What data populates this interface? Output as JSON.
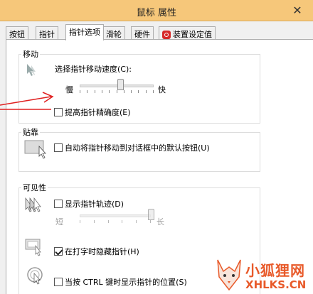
{
  "window": {
    "title": "鼠标 属性",
    "close_glyph": "✕"
  },
  "tabs": [
    {
      "label": "按钮"
    },
    {
      "label": "指针"
    },
    {
      "label": "指针选项"
    },
    {
      "label": "滑轮"
    },
    {
      "label": "硬件"
    },
    {
      "label": "装置设定值",
      "icon": "red-device-icon"
    }
  ],
  "motion": {
    "group_label": "移动",
    "speed_label": "选择指针移动速度(C):",
    "slow_label": "慢",
    "fast_label": "快",
    "speed_level": 0.55,
    "precision_label": "提高指针精确度(E)",
    "precision_checked": false
  },
  "snap": {
    "group_label": "贴靠",
    "label": "自动将指针移动到对话框中的默认按钮(U)",
    "checked": false
  },
  "visibility": {
    "group_label": "可见性",
    "trails_label": "显示指针轨迹(D)",
    "trails_checked": false,
    "short_label": "短",
    "long_label": "长",
    "trails_level": 1.0,
    "hide_label": "在打字时隐藏指针(H)",
    "hide_checked": true,
    "ctrl_label": "当按 CTRL 键时显示指针的位置(S)",
    "ctrl_checked": false
  },
  "watermark": {
    "line1": "小狐狸网",
    "line2": "XHLKS.CN"
  },
  "colors": {
    "titlebar": "#f6c77a",
    "annotation_arrow": "#e02020",
    "watermark": "#e85a2a"
  }
}
